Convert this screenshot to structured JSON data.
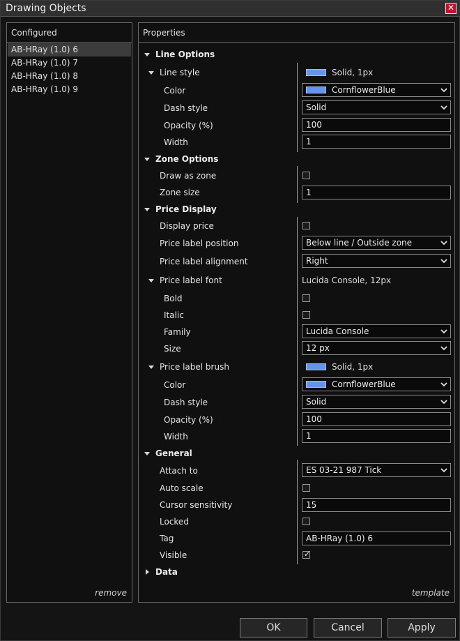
{
  "window": {
    "title": "Drawing Objects"
  },
  "configured": {
    "header": "Configured",
    "items": [
      "AB-HRay (1.0) 6",
      "AB-HRay (1.0) 7",
      "AB-HRay (1.0) 8",
      "AB-HRay (1.0) 9"
    ],
    "remove_label": "remove"
  },
  "properties": {
    "header": "Properties",
    "template_label": "template",
    "line_options": {
      "label": "Line Options",
      "line_style": {
        "label": "Line style",
        "summary": "Solid, 1px"
      },
      "color": {
        "label": "Color",
        "value": "CornflowerBlue"
      },
      "dash_style": {
        "label": "Dash style",
        "value": "Solid"
      },
      "opacity": {
        "label": "Opacity (%)",
        "value": "100"
      },
      "width": {
        "label": "Width",
        "value": "1"
      }
    },
    "zone_options": {
      "label": "Zone Options",
      "draw_as_zone": {
        "label": "Draw as zone",
        "checked": false
      },
      "zone_size": {
        "label": "Zone size",
        "value": "1"
      }
    },
    "price_display": {
      "label": "Price Display",
      "display_price": {
        "label": "Display price",
        "checked": false
      },
      "label_position": {
        "label": "Price label position",
        "value": "Below line / Outside zone"
      },
      "label_alignment": {
        "label": "Price label alignment",
        "value": "Right"
      },
      "label_font": {
        "label": "Price label font",
        "summary": "Lucida Console, 12px",
        "bold": {
          "label": "Bold",
          "checked": false
        },
        "italic": {
          "label": "Italic",
          "checked": false
        },
        "family": {
          "label": "Family",
          "value": "Lucida Console"
        },
        "size": {
          "label": "Size",
          "value": "12 px"
        }
      },
      "label_brush": {
        "label": "Price label brush",
        "summary": "Solid, 1px",
        "color": {
          "label": "Color",
          "value": "CornflowerBlue"
        },
        "dash_style": {
          "label": "Dash style",
          "value": "Solid"
        },
        "opacity": {
          "label": "Opacity (%)",
          "value": "100"
        },
        "width": {
          "label": "Width",
          "value": "1"
        }
      }
    },
    "general": {
      "label": "General",
      "attach_to": {
        "label": "Attach to",
        "value": "ES 03-21 987 Tick"
      },
      "auto_scale": {
        "label": "Auto scale",
        "checked": false
      },
      "cursor_sensitivity": {
        "label": "Cursor sensitivity",
        "value": "15"
      },
      "locked": {
        "label": "Locked",
        "checked": false
      },
      "tag": {
        "label": "Tag",
        "value": "AB-HRay (1.0) 6"
      },
      "visible": {
        "label": "Visible",
        "checked": true,
        "check_glyph": "✓"
      }
    },
    "data": {
      "label": "Data"
    }
  },
  "buttons": {
    "ok": "OK",
    "cancel": "Cancel",
    "apply": "Apply"
  },
  "colors": {
    "swatch": "#6495ed",
    "close": "#c8102e"
  },
  "icons": {
    "close": "close-icon",
    "expanded": "caret-down-icon",
    "collapsed": "caret-right-icon",
    "dropdown": "chevron-down-icon"
  }
}
